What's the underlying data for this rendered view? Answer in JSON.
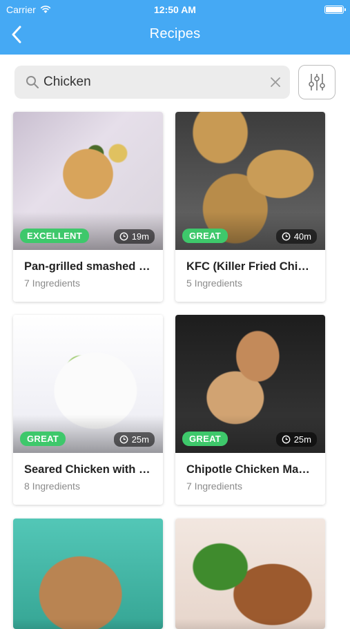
{
  "status_bar": {
    "carrier": "Carrier",
    "time": "12:50 AM",
    "battery_level": 1.0
  },
  "nav": {
    "title": "Recipes",
    "back_icon": "chevron-left-icon"
  },
  "search": {
    "value": "Chicken",
    "placeholder": "",
    "icon": "search-icon",
    "clear_icon": "close-icon"
  },
  "filter": {
    "icon": "sliders-icon"
  },
  "colors": {
    "header": "#45a9f4",
    "badge": "#3ec86b",
    "search_bg": "#ececec"
  },
  "recipes": [
    {
      "rating": "EXCELLENT",
      "time": "19m",
      "title": "Pan-grilled smashed c...",
      "ingredients": "7 Ingredients"
    },
    {
      "rating": "GREAT",
      "time": "40m",
      "title": "KFC (Killer Fried Chicken)",
      "ingredients": "5 Ingredients"
    },
    {
      "rating": "GREAT",
      "time": "25m",
      "title": "Seared Chicken with L...",
      "ingredients": "8 Ingredients"
    },
    {
      "rating": "GREAT",
      "time": "25m",
      "title": "Chipotle Chicken Marina...",
      "ingredients": "7 Ingredients"
    },
    {
      "rating": "",
      "time": "",
      "title": "",
      "ingredients": ""
    },
    {
      "rating": "",
      "time": "",
      "title": "",
      "ingredients": ""
    }
  ]
}
